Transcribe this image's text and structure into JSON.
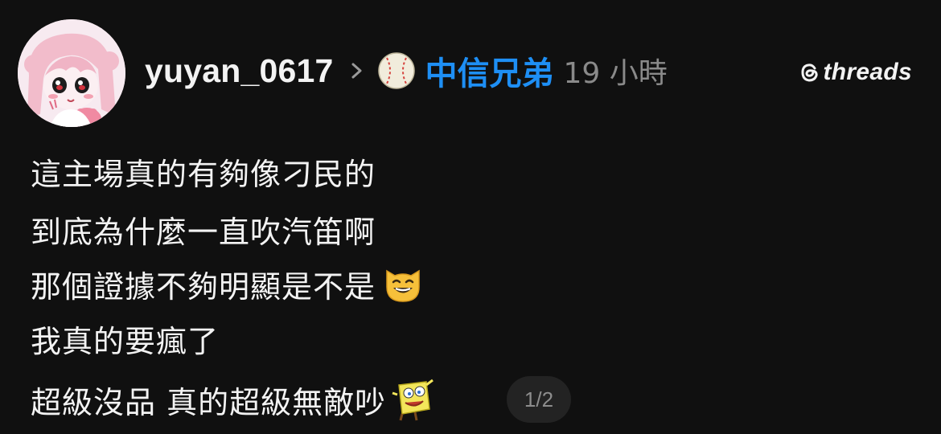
{
  "post": {
    "username": "yuyan_0617",
    "topic": "中信兄弟",
    "timestamp": "19 小時",
    "brand": "threads",
    "lines": [
      "這主場真的有夠像刁民的",
      "到底為什麼一直吹汽笛啊",
      "那個證據不夠明顯是不是",
      "我真的要瘋了",
      "超級沒品 真的超級無敵吵"
    ],
    "pager": "1/2",
    "icons": {
      "avatar": "anime-girl-avatar",
      "chevron": "chevron-right-icon",
      "topic": "baseball-icon",
      "brand": "threads-logo-icon",
      "emoji": "grinning-cat-emoji",
      "sticker": "spongebob-sticker"
    }
  },
  "colors": {
    "background": "#101010",
    "text": "#f3f3f3",
    "topic": "#1e8ff5",
    "muted": "#8a8a8a",
    "pager_bg": "#232323"
  }
}
